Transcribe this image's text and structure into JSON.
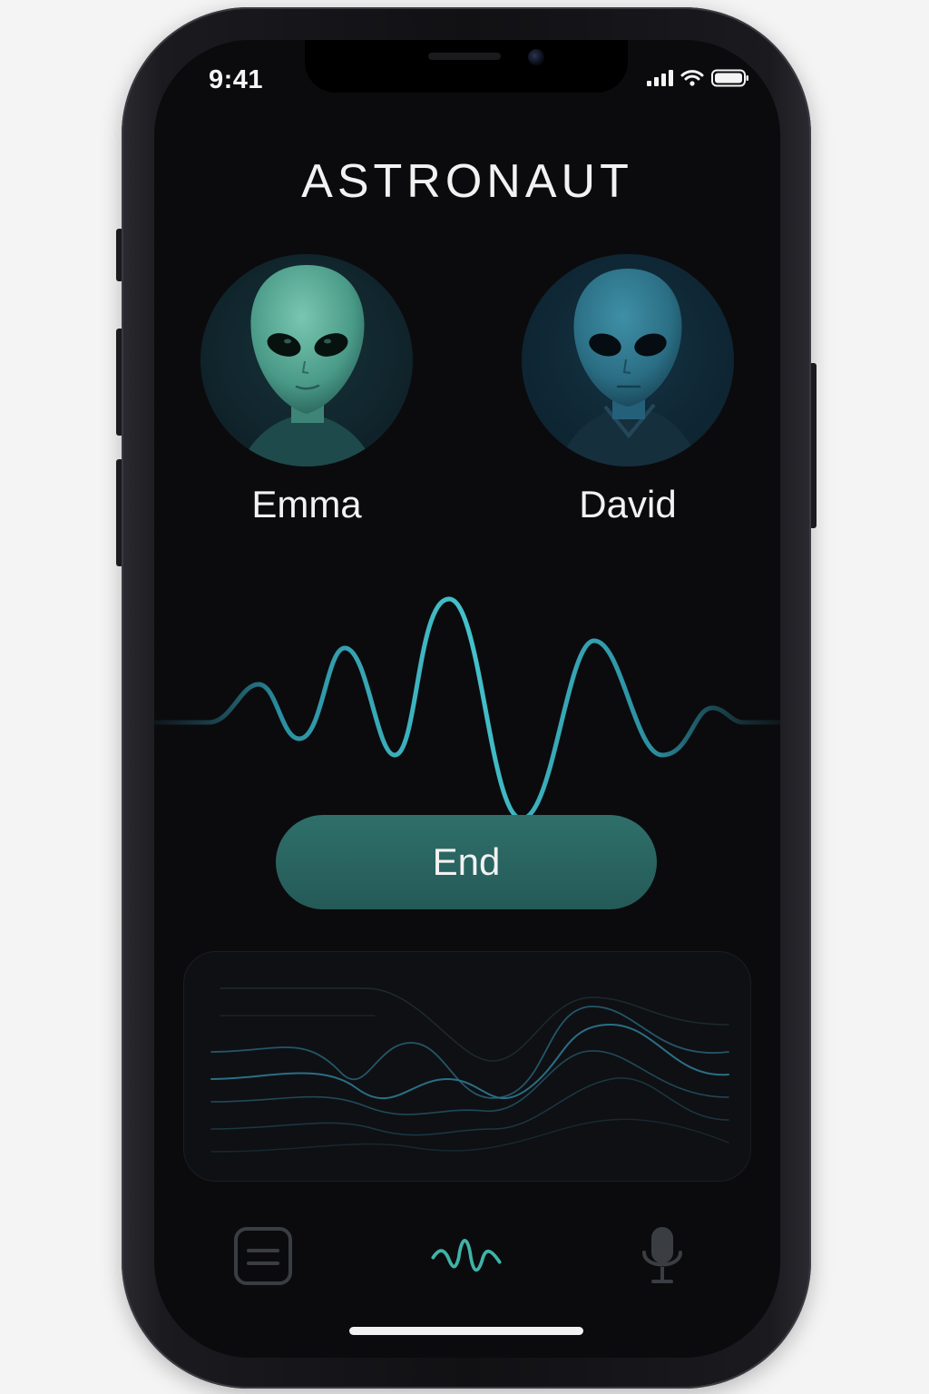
{
  "status_bar": {
    "time": "9:41",
    "icons": [
      "signal-icon",
      "wifi-icon",
      "battery-icon"
    ]
  },
  "app": {
    "title": "ASTRONAUT"
  },
  "participants": [
    {
      "name": "Emma",
      "avatar_icon": "alien-avatar",
      "tint": "#5fae9c"
    },
    {
      "name": "David",
      "avatar_icon": "alien-avatar",
      "tint": "#2f7a90"
    }
  ],
  "call": {
    "end_label": "End"
  },
  "bottom_nav": {
    "tabs": [
      {
        "icon": "list-icon",
        "active": false
      },
      {
        "icon": "waveform-icon",
        "active": true
      },
      {
        "icon": "microphone-icon",
        "active": false
      }
    ]
  },
  "colors": {
    "background": "#0b0b0d",
    "accent": "#3fb8c4",
    "end_button": "#2a6663",
    "inactive_icon": "#3a3d42"
  }
}
